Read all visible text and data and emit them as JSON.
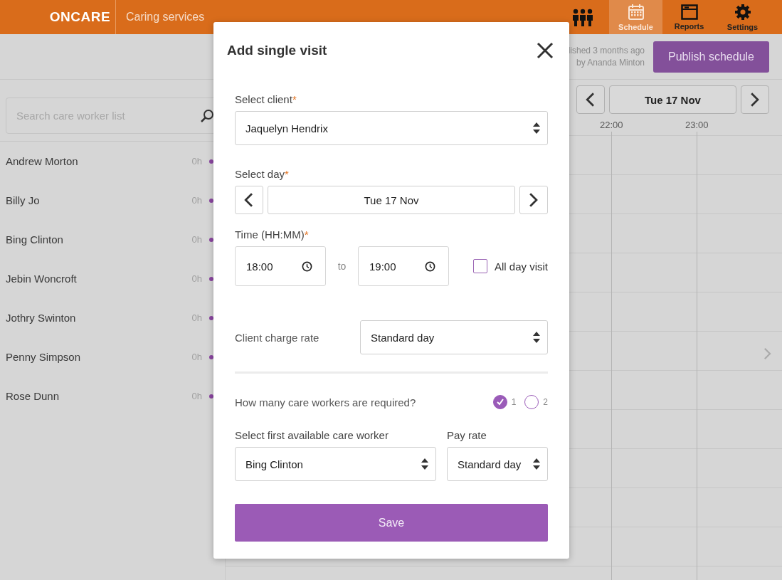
{
  "header": {
    "logo": "ONCARE",
    "subtitle": "Caring services",
    "nav": [
      {
        "kind": "team",
        "selected": false
      },
      {
        "kind": "calendar",
        "label": "Schedule",
        "selected": true
      },
      {
        "kind": "reports",
        "label": "Reports",
        "selected": false
      },
      {
        "kind": "settings",
        "label": "Settings",
        "selected": false
      }
    ]
  },
  "toolbar": {
    "publish_status": [
      "lished 3 months ago",
      "by Ananda Minton"
    ],
    "publish_button": "Publish schedule"
  },
  "sidebar": {
    "search": {
      "placeholder": "Search care worker list"
    },
    "workers": [
      {
        "name": "Andrew Morton",
        "hours": "0h"
      },
      {
        "name": "Billy Jo",
        "hours": "0h"
      },
      {
        "name": "Bing Clinton",
        "hours": "0h"
      },
      {
        "name": "Jebin Woncroft",
        "hours": "0h"
      },
      {
        "name": "Jothry Swinton",
        "hours": "0h"
      },
      {
        "name": "Penny Simpson",
        "hours": "0h"
      },
      {
        "name": "Rose Dunn",
        "hours": "0h"
      }
    ]
  },
  "calendar": {
    "date": "Tue 17 Nov",
    "times": [
      "22:00",
      "23:00"
    ]
  },
  "modal": {
    "title": "Add single visit",
    "client": {
      "label": "Select client",
      "required_mark": "*",
      "value": "Jaquelyn Hendrix"
    },
    "day": {
      "label": "Select day",
      "required_mark": "*",
      "value": "Tue 17 Nov"
    },
    "time": {
      "label": "Time (HH:MM)",
      "required_mark": "*",
      "from": "18:00",
      "separator": "to",
      "to": "19:00"
    },
    "all_day": {
      "label": "All day visit",
      "checked": false
    },
    "charge_rate": {
      "label": "Client charge rate",
      "value": "Standard day"
    },
    "workers_required": {
      "label": "How many care workers are required?",
      "options": [
        {
          "label": "1",
          "selected": true
        },
        {
          "label": "2",
          "selected": false
        }
      ]
    },
    "care_worker": {
      "label": "Select first available care worker",
      "value": "Bing Clinton"
    },
    "pay_rate": {
      "label": "Pay rate",
      "value": "Standard day"
    },
    "save": "Save"
  }
}
